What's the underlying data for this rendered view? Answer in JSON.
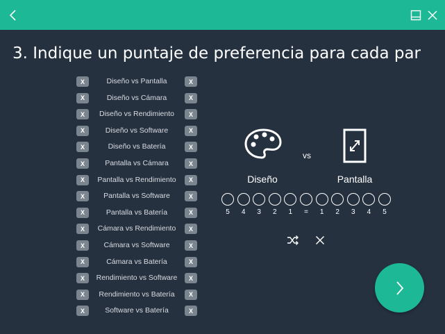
{
  "header": {
    "back_icon": "chevron-left-icon",
    "minimize_icon": "minimize-icon",
    "close_icon": "close-icon"
  },
  "title": "3. Indique un puntaje de preferencia para cada par",
  "pairs": [
    "Diseño vs Pantalla",
    "Diseño vs Cámara",
    "Diseño vs Rendimiento",
    "Diseño vs Software",
    "Diseño vs Batería",
    "Pantalla vs Cámara",
    "Pantalla vs Rendimiento",
    "Pantalla vs Software",
    "Pantalla vs Batería",
    "Cámara vs Rendimiento",
    "Cámara vs Software",
    "Cámara vs Batería",
    "Rendimiento vs Software",
    "Rendimiento vs Batería",
    "Software vs Batería"
  ],
  "remove_label": "X",
  "comparison": {
    "left": {
      "label": "Diseño",
      "icon": "palette-icon"
    },
    "right": {
      "label": "Pantalla",
      "icon": "phone-screen-icon"
    },
    "vs": "vs",
    "scale": [
      "5",
      "4",
      "3",
      "2",
      "1",
      "=",
      "1",
      "2",
      "3",
      "4",
      "5"
    ]
  },
  "actions": {
    "shuffle_icon": "shuffle-icon",
    "clear_icon": "clear-icon",
    "next_icon": "chevron-right-icon"
  },
  "colors": {
    "accent": "#1db895",
    "background": "#263140",
    "chip": "#7b858f"
  }
}
